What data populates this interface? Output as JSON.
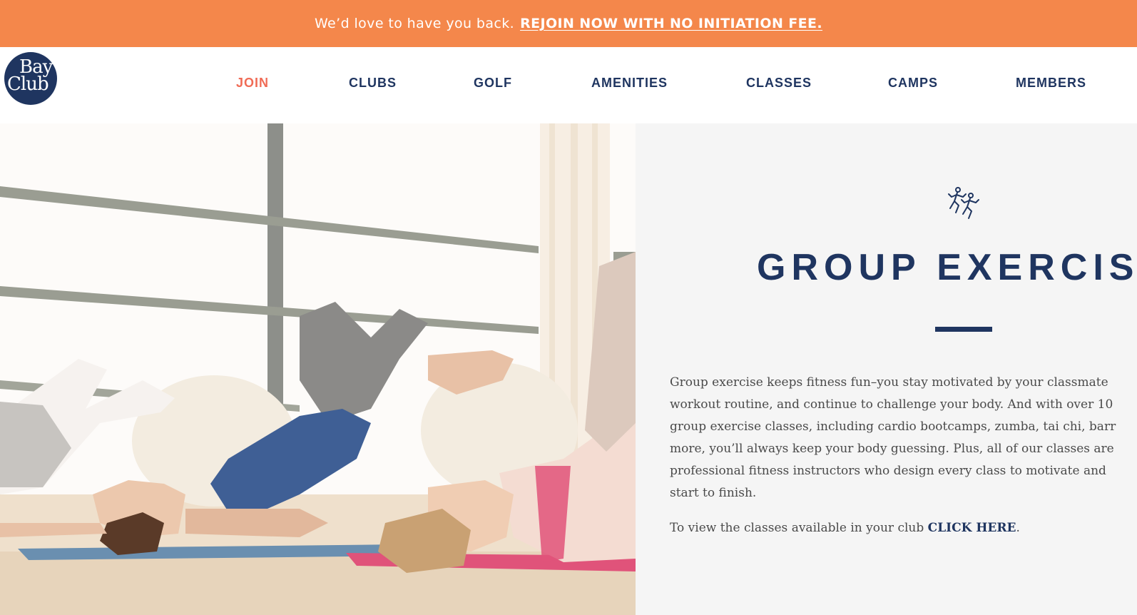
{
  "promo": {
    "lead": "We’d love to have you back.",
    "cta": "REJOIN NOW WITH NO INITIATION FEE.",
    "background": "#f4874b"
  },
  "logo": {
    "line1": "Bay",
    "line2": "Club"
  },
  "nav": {
    "items": [
      {
        "label": "JOIN",
        "active": true
      },
      {
        "label": "CLUBS"
      },
      {
        "label": "GOLF"
      },
      {
        "label": "AMENITIES"
      },
      {
        "label": "CLASSES"
      },
      {
        "label": "CAMPS"
      },
      {
        "label": "MEMBERS"
      }
    ],
    "active_color": "#f06b55",
    "color": "#1f3560"
  },
  "hero": {
    "icon": "group-exercise-photo"
  },
  "section": {
    "icon": "running-people-icon",
    "title": "GROUP EXERCIS",
    "body_lines": [
      "Group exercise keeps fitness fun–you stay motivated by your classmate",
      "workout routine, and continue to challenge your body. And with over 10",
      "group exercise classes, including cardio bootcamps, zumba, tai chi, barr",
      "more, you’ll always keep your body guessing. Plus, all of our classes are",
      "professional fitness instructors who design every class to motivate and",
      "start to finish."
    ],
    "view_prefix": "To view the classes available in your club ",
    "view_link": "CLICK HERE",
    "view_suffix": ".",
    "panel_background": "#f5f5f5"
  }
}
